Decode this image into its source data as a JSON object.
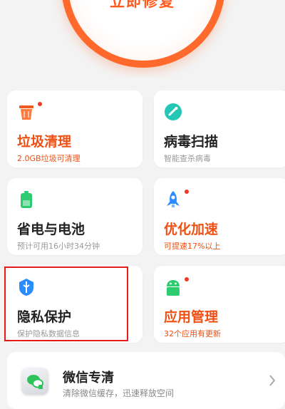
{
  "hero": {
    "fix_label": "立即修复"
  },
  "cards": [
    {
      "title": "垃圾清理",
      "subtitle": "2.0GB垃圾可清理",
      "icon": "trash-icon",
      "has_dot": true
    },
    {
      "title": "病毒扫描",
      "subtitle": "智能查杀病毒",
      "icon": "shield-check-icon",
      "has_dot": false
    },
    {
      "title": "省电与电池",
      "subtitle": "预计可用16小时34分钟",
      "icon": "battery-icon",
      "has_dot": false
    },
    {
      "title": "优化加速",
      "subtitle": "可提速17%以上",
      "icon": "rocket-icon",
      "has_dot": true
    },
    {
      "title": "隐私保护",
      "subtitle": "保护隐私数据信息",
      "icon": "privacy-shield-icon",
      "has_dot": false,
      "highlighted": true
    },
    {
      "title": "应用管理",
      "subtitle": "32个应用有更新",
      "icon": "android-app-icon",
      "has_dot": true
    }
  ],
  "wechat": {
    "title": "微信专清",
    "subtitle": "清除微信缓存，迅速释放空间",
    "icon": "wechat-clean-icon"
  },
  "colors": {
    "accent": "#ff6a2c",
    "warning_text": "#ee4f13",
    "teal": "#22c7b5",
    "green": "#2ecc71",
    "blue": "#2a8cff",
    "badge_dot": "#f2362a",
    "highlight_box": "#e21b1b"
  }
}
